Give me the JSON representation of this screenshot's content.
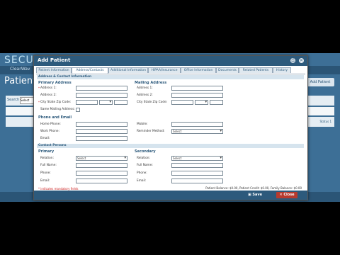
{
  "background_app": {
    "logo": "SECUR",
    "nav_item": "ClearWav",
    "page_title": "Patient N",
    "add_patient_button": "Add Patient",
    "search_label": "Search",
    "search_select": "Select",
    "row_label": "Status 1",
    "accent": "#3d6f96"
  },
  "modal": {
    "title": "Add Patient",
    "tabs": [
      "Patient Information",
      "Address/Contacts",
      "Additional Information",
      "HIPAA/Insurance",
      "Office Information",
      "Documents",
      "Related Patients",
      "History"
    ],
    "active_tab": "Address/Contacts",
    "section_address": "Address & Contact Information",
    "primary_address": "Primary Address",
    "mailing_address": "Mailing Address",
    "labels": {
      "address1": "Address 1:",
      "address2": "Address 2:",
      "city_state_zip": "City State Zip Code:",
      "same_mailing": "Same Mailing Address:",
      "phone_email": "Phone and Email",
      "home_phone": "Home Phone:",
      "work_phone": "Work Phone:",
      "email": "Email:",
      "mobile": "Mobile:",
      "reminder_method": "Reminder Method:"
    },
    "required_mark": "*",
    "select_placeholder": "Select",
    "section_contacts": "Contact Persons",
    "primary": "Primary",
    "secondary": "Secondary",
    "contact_labels": {
      "relation": "Relation:",
      "full_name": "Full Name:",
      "phone": "Phone:",
      "email": "Email:"
    },
    "required_note": "* indicates mandatory fields",
    "balances": "Patient Balance: $0.00, Patient Credit: $0.00, Family Balance: $0.00",
    "save_label": "Save",
    "close_label": "Close",
    "header_color": "#2d5a7c",
    "close_color": "#b73a2e"
  }
}
